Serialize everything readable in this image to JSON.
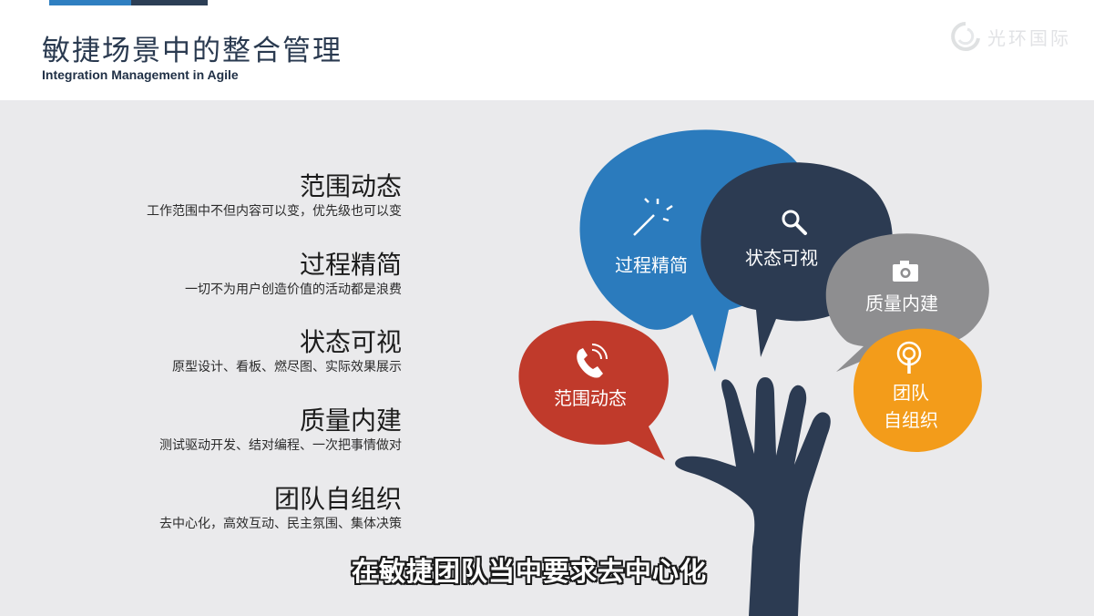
{
  "header": {
    "title_cn": "敏捷场景中的整合管理",
    "title_en": "Integration Management in Agile",
    "logo_text": "光环国际",
    "logo_icon": "ring-logo-icon"
  },
  "items": [
    {
      "title": "范围动态",
      "desc": "工作范围中不但内容可以变，优先级也可以变"
    },
    {
      "title": "过程精简",
      "desc": "一切不为用户创造价值的活动都是浪费"
    },
    {
      "title": "状态可视",
      "desc": "原型设计、看板、燃尽图、实际效果展示"
    },
    {
      "title": "质量内建",
      "desc": "测试驱动开发、结对编程、一次把事情做对"
    },
    {
      "title": "团队自组织",
      "desc": "去中心化，高效互动、民主氛围、集体决策"
    }
  ],
  "bubbles": {
    "process": {
      "label": "过程精简",
      "icon": "magic-wand-icon",
      "color": "#2b7bbd"
    },
    "status": {
      "label": "状态可视",
      "icon": "magnifier-icon",
      "color": "#2c3b52"
    },
    "quality": {
      "label": "质量内建",
      "icon": "camera-icon",
      "color": "#8e8e90"
    },
    "scope": {
      "label": "范围动态",
      "icon": "phone-icon",
      "color": "#c03a2b"
    },
    "team": {
      "label_line1": "团队",
      "label_line2": "自组织",
      "icon": "podcast-icon",
      "color": "#f39c1a"
    }
  },
  "hand": {
    "icon": "hand-icon",
    "color": "#2c3b52"
  },
  "subtitle": "在敏捷团队当中要求去中心化"
}
